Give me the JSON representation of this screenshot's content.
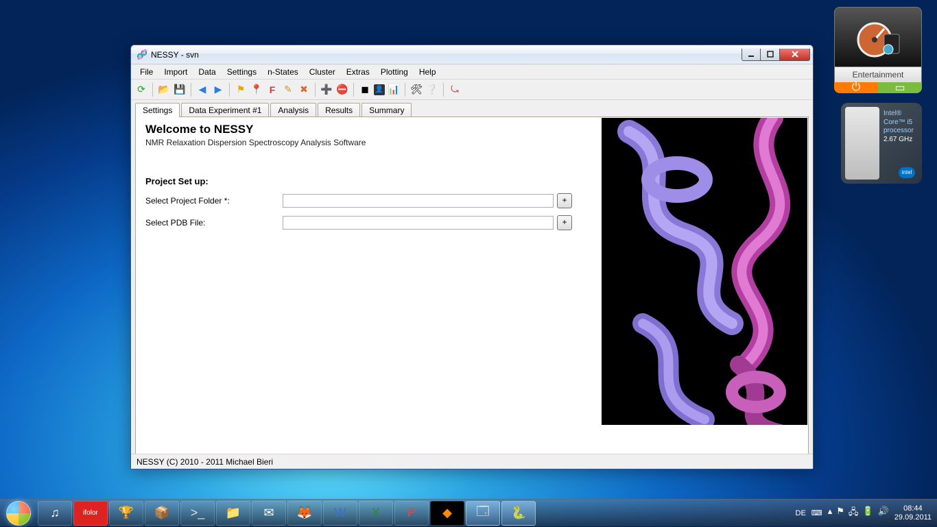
{
  "window": {
    "title": "NESSY - svn",
    "menus": [
      "File",
      "Import",
      "Data",
      "Settings",
      "n-States",
      "Cluster",
      "Extras",
      "Plotting",
      "Help"
    ],
    "tabs": [
      "Settings",
      "Data Experiment #1",
      "Analysis",
      "Results",
      "Summary"
    ],
    "active_tab": 0,
    "welcome": "Welcome to NESSY",
    "subtitle": "NMR Relaxation Dispersion Spectroscopy Analysis Software",
    "section": "Project Set up:",
    "fields": {
      "project_folder": {
        "label": "Select Project Folder *:",
        "value": ""
      },
      "pdb_file": {
        "label": "Select PDB File:",
        "value": ""
      }
    },
    "plus": "+",
    "status": "NESSY (C) 2010 - 2011 Michael Bieri"
  },
  "gadgets": {
    "entertainment_label": "Entertainment",
    "cpu": {
      "line1": "Intel®",
      "line2": "Core™ i5",
      "line3": "processor",
      "line4": "2.67 GHz",
      "badge": "intel"
    }
  },
  "taskbar": {
    "lang": "DE",
    "time": "08:44",
    "date": "29.09.2011"
  }
}
